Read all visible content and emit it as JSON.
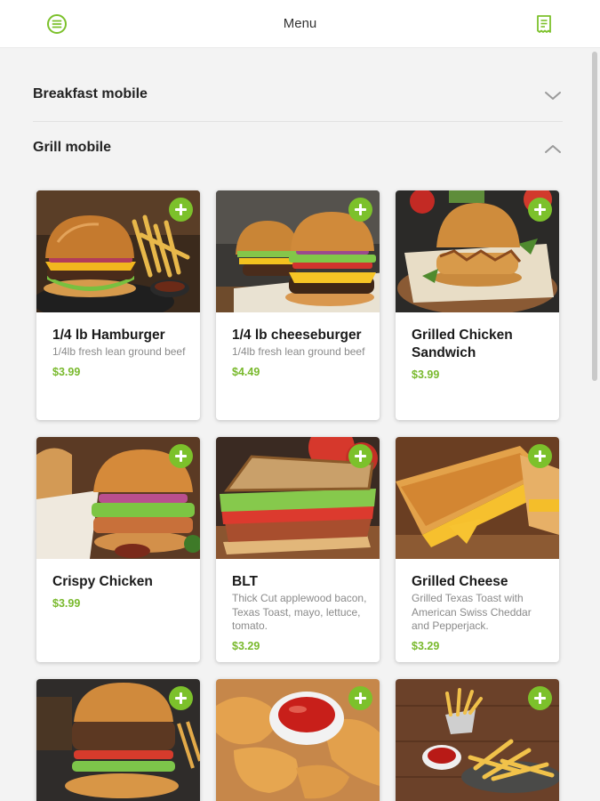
{
  "header": {
    "title": "Menu",
    "menu_icon": "hamburger-circle-icon",
    "order_icon": "receipt-icon"
  },
  "sections": [
    {
      "label": "Breakfast mobile",
      "state": "collapsed",
      "icon": "chevron-down-icon"
    },
    {
      "label": "Grill mobile",
      "state": "expanded",
      "icon": "chevron-up-icon"
    }
  ],
  "items": [
    {
      "name": "1/4 lb Hamburger",
      "description": "1/4lb fresh lean ground beef",
      "price": "$3.99",
      "image": "hamburger-with-fries"
    },
    {
      "name": "1/4 lb cheeseburger",
      "description": "1/4lb fresh lean ground beef",
      "price": "$4.49",
      "image": "two-cheeseburgers"
    },
    {
      "name": "Grilled Chicken Sandwich",
      "description": "",
      "price": "$3.99",
      "image": "grilled-chicken-sandwich"
    },
    {
      "name": "Crispy Chicken",
      "description": "",
      "price": "$3.99",
      "image": "crispy-chicken-sandwich"
    },
    {
      "name": "BLT",
      "description": "Thick Cut applewood bacon, Texas Toast, mayo, lettuce, tomato.",
      "price": "$3.29",
      "image": "blt-sandwich"
    },
    {
      "name": "Grilled Cheese",
      "description": "Grilled Texas Toast with American Swiss Cheddar and Pepperjack.",
      "price": "$3.29",
      "image": "grilled-cheese"
    },
    {
      "name": "",
      "description": "",
      "price": "",
      "image": "veggie-burger"
    },
    {
      "name": "",
      "description": "",
      "price": "",
      "image": "chicken-tenders-with-ketchup"
    },
    {
      "name": "",
      "description": "",
      "price": "",
      "image": "french-fries-basket"
    }
  ],
  "colors": {
    "accent": "#7cc12b",
    "price": "#79b92d",
    "background": "#f3f3f3",
    "header": "#ffffff"
  }
}
